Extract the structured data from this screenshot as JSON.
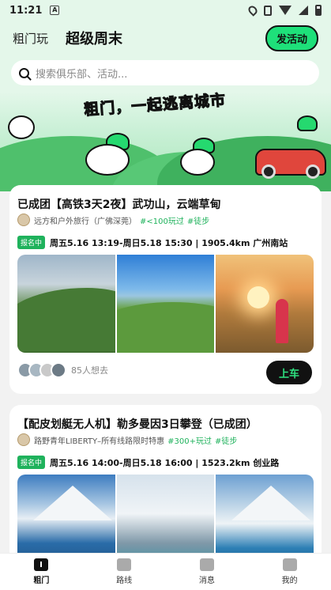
{
  "status_bar": {
    "time": "11:21",
    "a_badge": "A"
  },
  "header": {
    "tabs": [
      {
        "label": "粗门玩",
        "active": false
      },
      {
        "label": "超级周末",
        "active": true
      }
    ],
    "post_button": "发活动"
  },
  "search": {
    "placeholder": "搜索俱乐部、活动..."
  },
  "banner": {
    "slogan": "粗门，一起逃离城市"
  },
  "cards": [
    {
      "title": "已成团【高铁3天2夜】武功山，云端草甸",
      "organizer": "远方和户外旅行（广佛深莞）",
      "tags": [
        "#<100玩过",
        "#徒步"
      ],
      "status_badge": "报名中",
      "schedule": "周五5.16 13:19-周日5.18 15:30 | 1905.4km 广州南站",
      "want_count": "85人想去",
      "action_label": "上车"
    },
    {
      "title": "【配皮划艇无人机】勒多曼因3日攀登（已成团）",
      "organizer": "路野青年LIBERTY–所有线路限时特惠",
      "tags": [
        "#300+玩过",
        "#徒步"
      ],
      "status_badge": "报名中",
      "schedule": "周五5.16 14:00-周日5.18 16:00 | 1523.2km 创业路"
    }
  ],
  "bottom_nav": [
    {
      "label": "粗门",
      "icon": "home-icon",
      "active": true
    },
    {
      "label": "路线",
      "icon": "route-icon",
      "active": false
    },
    {
      "label": "消息",
      "icon": "message-icon",
      "active": false
    },
    {
      "label": "我的",
      "icon": "profile-icon",
      "active": false
    }
  ],
  "colors": {
    "brand_green": "#1ee07a",
    "tag_green": "#1fb25c",
    "header_bg": "#e4f7ea"
  }
}
